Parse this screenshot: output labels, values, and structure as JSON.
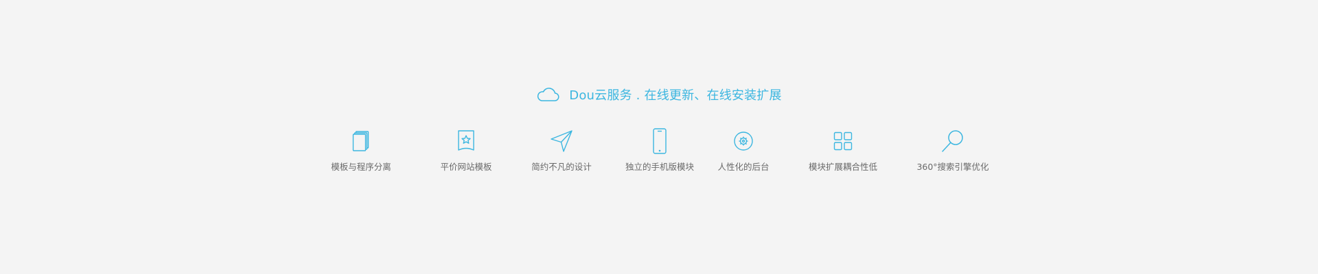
{
  "header": {
    "icon": "cloud-icon",
    "title": "Dou云服务 . 在线更新、在线安装扩展"
  },
  "features": [
    {
      "icon": "copy-documents-icon",
      "label": "模板与程序分离"
    },
    {
      "icon": "star-bookmark-icon",
      "label": "平价网站模板"
    },
    {
      "icon": "paper-plane-icon",
      "label": "简约不凡的设计"
    },
    {
      "icon": "mobile-phone-icon",
      "label": "独立的手机版模块"
    },
    {
      "icon": "gear-circle-icon",
      "label": "人性化的后台"
    },
    {
      "icon": "grid-modules-icon",
      "label": "模块扩展耦合性低"
    },
    {
      "icon": "search-icon",
      "label": "360°搜索引擎优化"
    }
  ],
  "colors": {
    "accent": "#3bb6e0",
    "label_text": "#6a6a6a",
    "background": "#f4f4f4"
  }
}
